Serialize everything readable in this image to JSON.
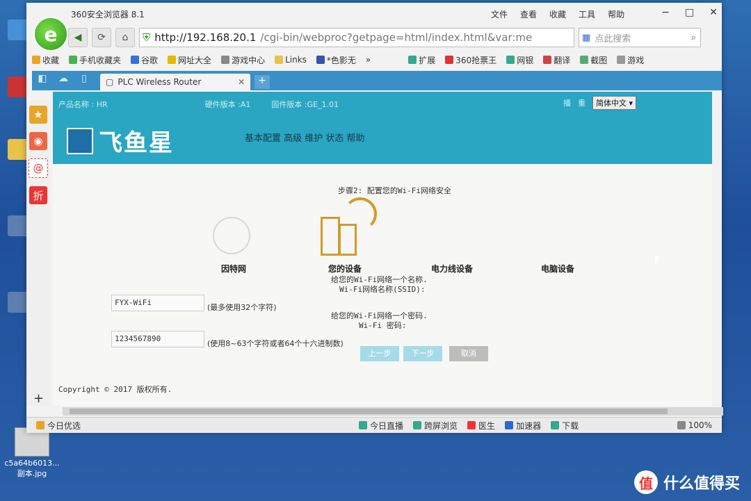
{
  "desktop": {
    "photo_icon_label": "c5a64b6013...副本.jpg",
    "watermark_text": "什么值得买",
    "watermark_badge": "值"
  },
  "browser": {
    "title": "360安全浏览器 8.1",
    "menus": [
      "文件",
      "查看",
      "收藏",
      "工具",
      "帮助"
    ],
    "address_host": "http://192.168.20.1",
    "address_rest": "/cgi-bin/webproc?getpage=html/index.html&var:me",
    "search_placeholder": "点此搜索",
    "bookmarks": [
      "收藏",
      "手机收藏夹",
      "谷歌",
      "网址大全",
      "游戏中心",
      "Links",
      "*色影无",
      "扩展",
      "360抢票王",
      "网银",
      "翻译",
      "截图",
      "游戏"
    ],
    "tab_title": "PLC Wireless Router",
    "status_left": "今日优选",
    "status_items": [
      "今日直播",
      "跨屏浏览",
      "医生",
      "加速器",
      "下载"
    ],
    "zoom": "100%"
  },
  "router": {
    "product_label": "产品名称 : HR",
    "hw_label": "硬件版本 :A1",
    "fw_label": "固件版本 :GE_1.01",
    "lang_icons": [
      "播",
      "重"
    ],
    "lang_select": "简体中文",
    "brand": "飞鱼星",
    "nav_text": "基本配置 高级 维护 状态 帮助",
    "step_title": "步骤2: 配置您的Wi-Fi网络安全",
    "labels": {
      "internet": "因特网",
      "your_device": "您的设备",
      "powerline": "电力线设备",
      "computer": "电脑设备"
    },
    "ssid_desc1": "给您的Wi-Fi网络一个名称.",
    "ssid_desc2": "Wi-Fi网络名称(SSID):",
    "ssid_value": "FYX-WiFi",
    "ssid_hint": "(最多使用32个字符)",
    "pw_desc1": "给您的Wi-Fi网络一个密码.",
    "pw_desc2": "Wi-Fi 密码:",
    "pw_value": "1234567890",
    "pw_hint": "(使用8~63个字符或者64个十六进制数)",
    "btn_prev": "上一步",
    "btn_next": "下一步",
    "btn_cancel": "取消",
    "copyright": "Copyright © 2017 版权所有."
  }
}
